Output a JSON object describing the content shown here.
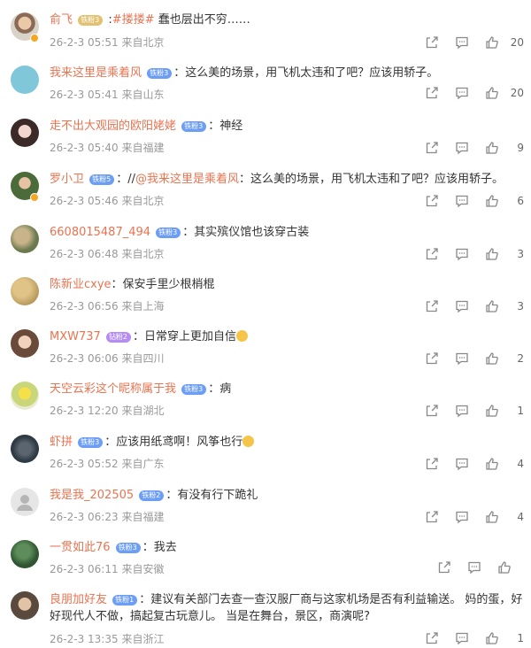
{
  "colors": {
    "accent": "#eb7350",
    "meta": "#999999",
    "badge_blue": "#6d9ef6",
    "badge_purple": "#b48cf2"
  },
  "comments": [
    {
      "user": "俞飞",
      "badge": "铁粉3",
      "tag": "#搂搂#",
      "text": " 蠢也层出不穷……",
      "date": "26-2-3",
      "time": "05:51",
      "location": "来自北京",
      "likes": "20"
    },
    {
      "user": "我来这里是乘着风",
      "badge": "铁粉3",
      "text": "：这么美的场景，用飞机太违和了吧？应该用轿子。",
      "date": "26-2-3",
      "time": "05:41",
      "location": "来自山东",
      "likes": "20"
    },
    {
      "user": "走不出大观园的欧阳姥姥",
      "badge": "铁粉3",
      "text": "：神经",
      "date": "26-2-3",
      "time": "05:40",
      "location": "来自福建",
      "likes": "9"
    },
    {
      "user": "罗小卫",
      "badge": "铁粉5",
      "mention": "@我来这里是乘着风",
      "text_pre": "：//",
      "text": "：这么美的场景，用飞机太违和了吧？应该用轿子。",
      "date": "26-2-3",
      "time": "05:46",
      "location": "来自北京",
      "likes": "6"
    },
    {
      "user": "6608015487_494",
      "badge": "铁粉3",
      "text": "：其实殡仪馆也该穿古装",
      "date": "26-2-3",
      "time": "06:48",
      "location": "来自北京",
      "likes": "3"
    },
    {
      "user": "陈新业cxye",
      "text": "：保安手里少根梢棍",
      "date": "26-2-3",
      "time": "06:56",
      "location": "来自上海",
      "likes": "3"
    },
    {
      "user": "MXW737",
      "badge": "钻粉2",
      "text": "：日常穿上更加自信",
      "date": "26-2-3",
      "time": "06:06",
      "location": "来自四川",
      "likes": "2"
    },
    {
      "user": "天空云彩这个昵称属于我",
      "badge": "铁粉3",
      "text": "：病",
      "date": "26-2-3",
      "time": "12:20",
      "location": "来自湖北",
      "likes": "1"
    },
    {
      "user": "虾拼",
      "badge": "铁粉3",
      "text": "：应该用纸鸢啊！风筝也行",
      "date": "26-2-3",
      "time": "05:52",
      "location": "来自广东",
      "likes": "4"
    },
    {
      "user": "我是我_202505",
      "badge": "铁粉2",
      "text": "：有没有行下跪礼",
      "date": "26-2-3",
      "time": "06:23",
      "location": "来自福建",
      "likes": "4"
    },
    {
      "user": "一贯如此76",
      "badge": "铁粉3",
      "text": "：我去",
      "date": "26-2-3",
      "time": "06:11",
      "location": "来自安徽",
      "likes": ""
    },
    {
      "user": "良朋加好友",
      "badge": "铁粉1",
      "text": "：建议有关部门去查一查汉服厂商与这家机场是否有利益输送。 妈的蛋，好好现代人不做，搞起复古玩意儿。 当是在舞台，景区，商演呢?",
      "date": "26-2-3",
      "time": "13:35",
      "location": "来自浙江",
      "likes": "1"
    }
  ]
}
